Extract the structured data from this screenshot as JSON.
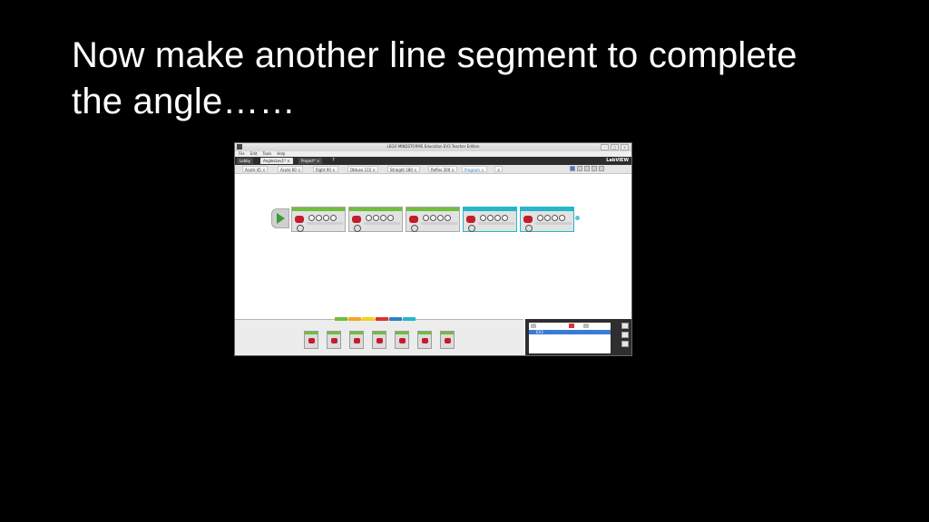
{
  "slide": {
    "title_line1": "Now make another line segment to complete",
    "title_line2": "the angle……"
  },
  "window": {
    "title": "LEGO MINDSTORMS Education EV3 Teacher Edition",
    "controls": [
      "–",
      "□",
      "×"
    ]
  },
  "menu": [
    "File",
    "Edit",
    "Tools",
    "Help"
  ],
  "project_tabs": [
    {
      "label": "Lobby",
      "active": false
    },
    {
      "label": "AnglesLev1* ×",
      "active": true
    },
    {
      "label": "Project* ×",
      "active": false
    }
  ],
  "help_label": "?",
  "brand": "LabVIEW",
  "program_tabs": [
    {
      "label": "Acute 45 ×",
      "active": false
    },
    {
      "label": "Acute 60 ×",
      "active": false
    },
    {
      "label": "Right 90 ×",
      "active": false
    },
    {
      "label": "Obtuse 115 ×",
      "active": false
    },
    {
      "label": "Straight 180 ×",
      "active": false
    },
    {
      "label": "Reflex 200 ×",
      "active": false
    },
    {
      "label": "Program ×",
      "active": true
    },
    {
      "label": "+",
      "active": false
    }
  ],
  "program_blocks": {
    "count": 5,
    "selected_index": 3,
    "colors": {
      "action": "#6fbf3a",
      "selected": "#25b6c9",
      "motor": "#c21d2b"
    }
  },
  "palette": {
    "categories": [
      "#6fbf3a",
      "#f5a623",
      "#f2d21b",
      "#d9342b",
      "#2f7fc1",
      "#25b6c9"
    ],
    "block_count": 7
  },
  "hardware": {
    "row_label": "EV3"
  }
}
